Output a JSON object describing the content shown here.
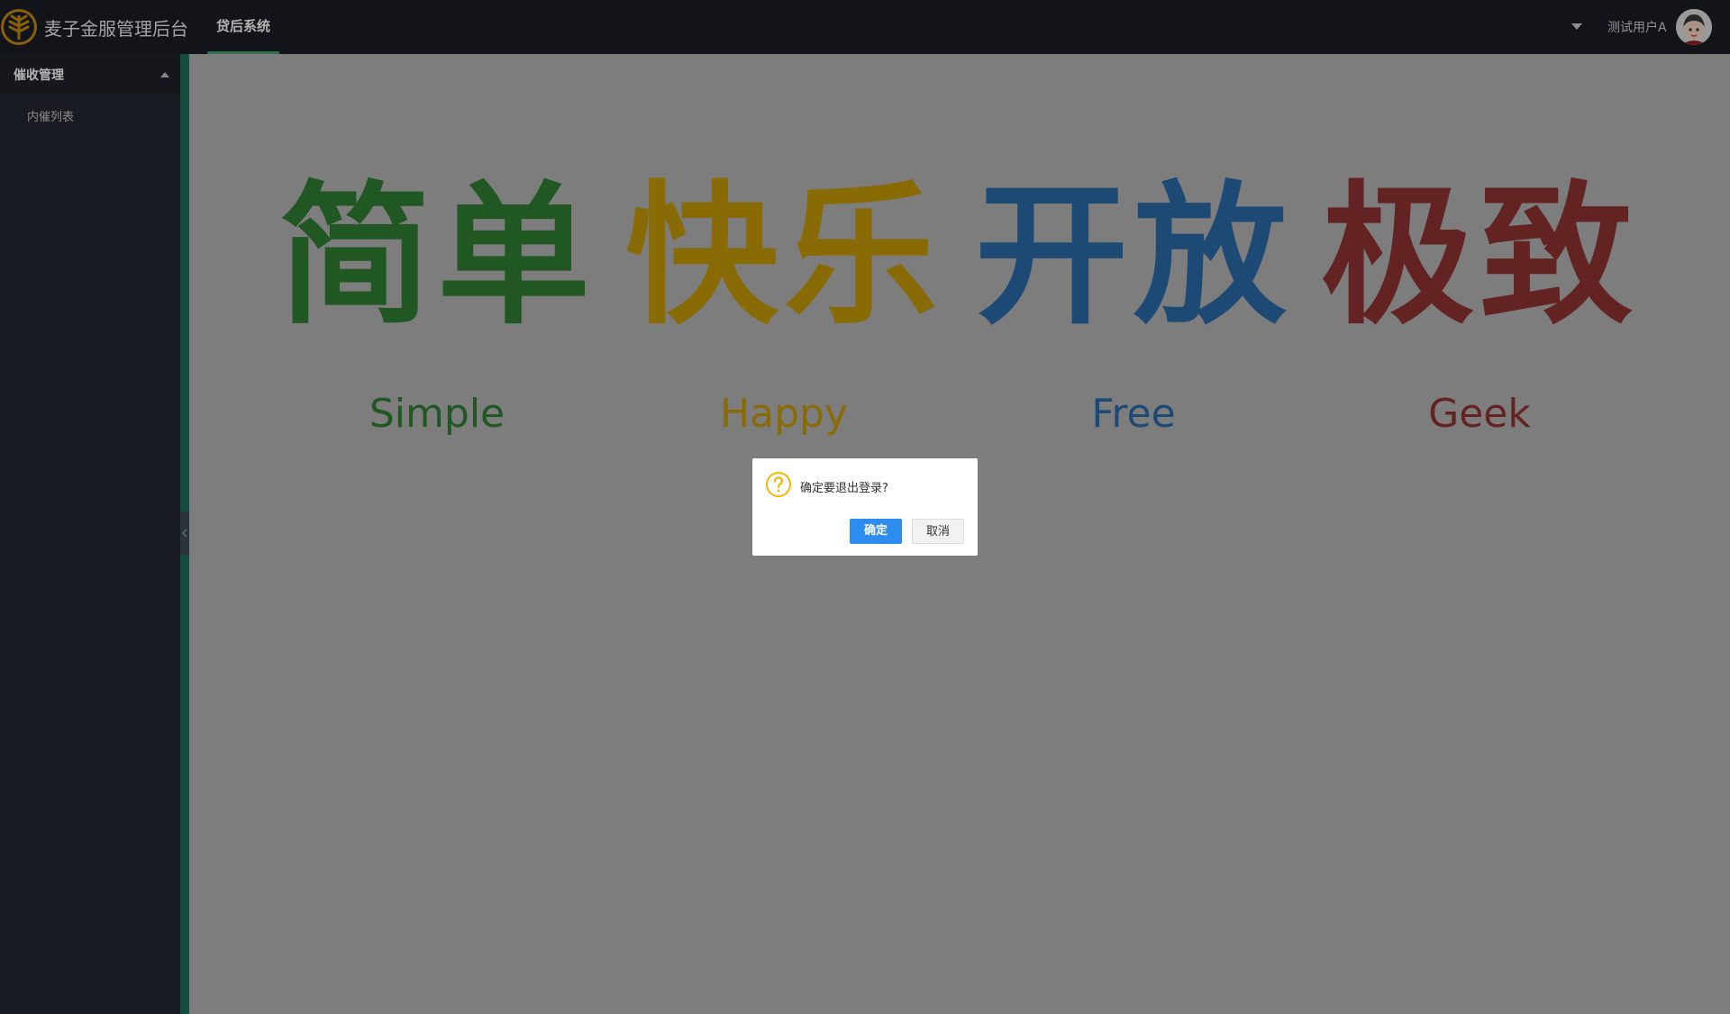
{
  "header": {
    "app_title": "麦子金服管理后台",
    "active_tab": "贷后系统",
    "user_name": "测试用户A",
    "icons": {
      "logo": "wheat-logo-icon",
      "user_menu": "caret-down-icon",
      "avatar": "user-avatar"
    }
  },
  "sidebar": {
    "group": {
      "label": "催收管理",
      "icon": "chevron-up-icon"
    },
    "items": [
      {
        "label": "内催列表"
      }
    ]
  },
  "hero": {
    "words": [
      {
        "zh": "简单",
        "en": "Simple",
        "color": "#2f7d32"
      },
      {
        "zh": "快乐",
        "en": "Happy",
        "color": "#c49a0a"
      },
      {
        "zh": "开放",
        "en": "Free",
        "color": "#2a6aa8"
      },
      {
        "zh": "极致",
        "en": "Geek",
        "color": "#8e3333"
      }
    ]
  },
  "dialog": {
    "message": "确定要退出登录?",
    "confirm_label": "确定",
    "cancel_label": "取消",
    "icon": "question-icon"
  },
  "colors": {
    "topbar": "#1c1e24",
    "sidebar": "#242832",
    "accent": "#3fa26f",
    "primary_button": "#2d8cf0"
  }
}
